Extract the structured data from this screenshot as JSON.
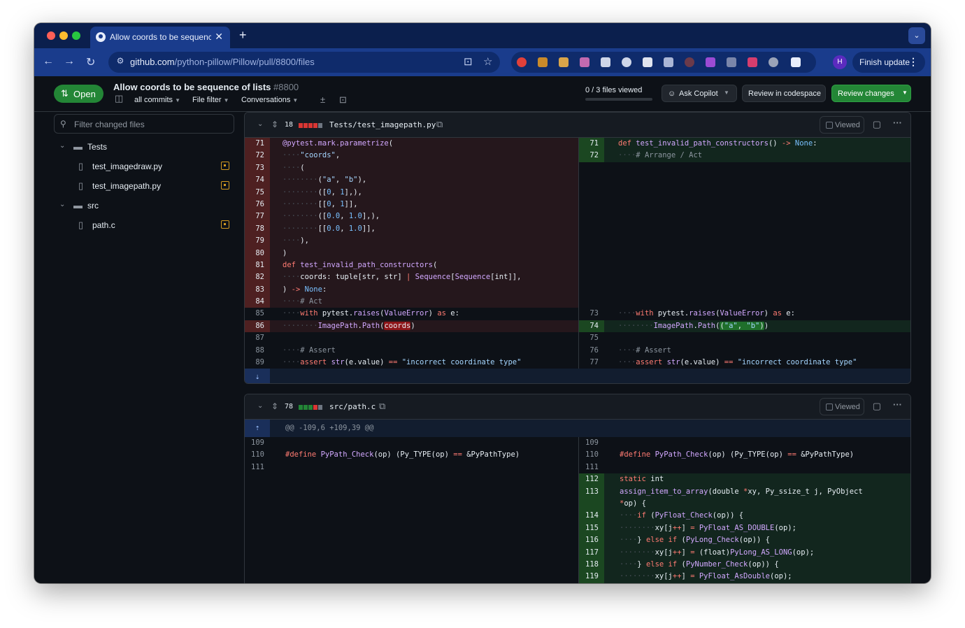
{
  "browser": {
    "tab_title": "Allow coords to be sequence",
    "tab_close": "✕",
    "new_tab": "+",
    "url_host": "github.com",
    "url_path": "/python-pillow/Pillow/pull/8800/files",
    "profile_initial": "H",
    "finish_update": "Finish update"
  },
  "pr": {
    "status": "Open",
    "title": "Allow coords to be sequence of lists",
    "number": "#8800",
    "filters": [
      "all commits",
      "File filter",
      "Conversations"
    ],
    "files_viewed": "0 / 3 files viewed",
    "ask_copilot": "Ask Copilot",
    "review_codespace": "Review in codespace",
    "review_changes": "Review changes"
  },
  "sidebar": {
    "filter_placeholder": "Filter changed files",
    "tree": [
      {
        "type": "dir",
        "name": "Tests"
      },
      {
        "type": "file",
        "name": "test_imagedraw.py"
      },
      {
        "type": "file",
        "name": "test_imagepath.py"
      },
      {
        "type": "dir",
        "name": "src"
      },
      {
        "type": "file",
        "name": "path.c"
      }
    ]
  },
  "files": [
    {
      "changes": "18",
      "path": "Tests/test_imagepath.py",
      "viewed_label": "Viewed"
    },
    {
      "changes": "78",
      "path": "src/path.c",
      "viewed_label": "Viewed",
      "hunk": "@@ -109,6 +109,39 @@"
    }
  ],
  "colors": {
    "added": "#238636",
    "deleted": "#da3633",
    "modified": "#d29922",
    "accent": "#1f6feb"
  },
  "icons": [
    "github-icon",
    "search-icon",
    "folder-icon",
    "file-icon",
    "copy-icon",
    "comment-icon",
    "kebab-icon",
    "expand-icon",
    "chevron-down-icon"
  ]
}
